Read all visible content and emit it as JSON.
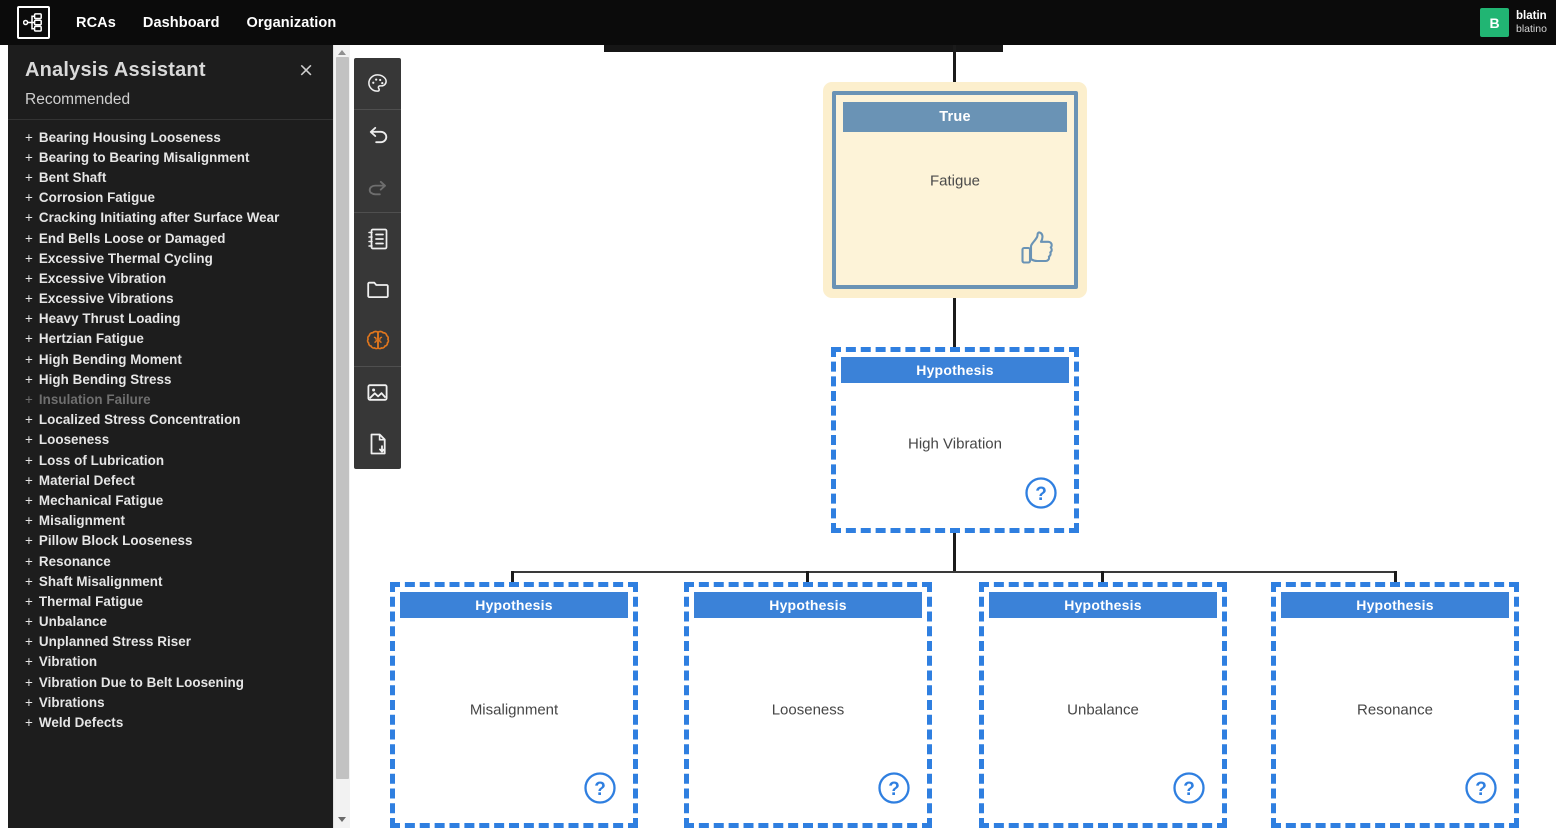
{
  "nav": {
    "logo_icon": "rca-tree-logo-icon",
    "links": [
      {
        "label": "RCAs"
      },
      {
        "label": "Dashboard"
      },
      {
        "label": "Organization"
      }
    ],
    "user": {
      "avatar_initial": "B",
      "name": "blatin",
      "sub": "blatino"
    }
  },
  "panel": {
    "title": "Analysis Assistant",
    "close_label": "×",
    "section_label": "Recommended",
    "items": [
      {
        "label": "Bearing Housing Looseness",
        "disabled": false
      },
      {
        "label": "Bearing to Bearing Misalignment",
        "disabled": false
      },
      {
        "label": "Bent Shaft",
        "disabled": false
      },
      {
        "label": "Corrosion Fatigue",
        "disabled": false
      },
      {
        "label": "Cracking Initiating after Surface Wear",
        "disabled": false
      },
      {
        "label": "End Bells Loose or Damaged",
        "disabled": false
      },
      {
        "label": "Excessive Thermal Cycling",
        "disabled": false
      },
      {
        "label": "Excessive Vibration",
        "disabled": false
      },
      {
        "label": "Excessive Vibrations",
        "disabled": false
      },
      {
        "label": "Heavy Thrust Loading",
        "disabled": false
      },
      {
        "label": "Hertzian Fatigue",
        "disabled": false
      },
      {
        "label": "High Bending Moment",
        "disabled": false
      },
      {
        "label": "High Bending Stress",
        "disabled": false
      },
      {
        "label": "Insulation Failure",
        "disabled": true
      },
      {
        "label": "Localized Stress Concentration",
        "disabled": false
      },
      {
        "label": "Looseness",
        "disabled": false
      },
      {
        "label": "Loss of Lubrication",
        "disabled": false
      },
      {
        "label": "Material Defect",
        "disabled": false
      },
      {
        "label": "Mechanical Fatigue",
        "disabled": false
      },
      {
        "label": "Misalignment",
        "disabled": false
      },
      {
        "label": "Pillow Block Looseness",
        "disabled": false
      },
      {
        "label": "Resonance",
        "disabled": false
      },
      {
        "label": "Shaft Misalignment",
        "disabled": false
      },
      {
        "label": "Thermal Fatigue",
        "disabled": false
      },
      {
        "label": "Unbalance",
        "disabled": false
      },
      {
        "label": "Unplanned Stress Riser",
        "disabled": false
      },
      {
        "label": "Vibration",
        "disabled": false
      },
      {
        "label": "Vibration Due to Belt Loosening",
        "disabled": false
      },
      {
        "label": "Vibrations",
        "disabled": false
      },
      {
        "label": "Weld Defects",
        "disabled": false
      }
    ],
    "plus_glyph": "+"
  },
  "toolbar": {
    "groups": [
      [
        {
          "icon": "palette-icon",
          "active": false,
          "disabled": false
        }
      ],
      [
        {
          "icon": "undo-icon",
          "active": false,
          "disabled": false
        },
        {
          "icon": "redo-icon",
          "active": false,
          "disabled": true
        }
      ],
      [
        {
          "icon": "notebook-icon",
          "active": false,
          "disabled": false
        },
        {
          "icon": "folder-icon",
          "active": false,
          "disabled": false
        },
        {
          "icon": "brain-icon",
          "active": true,
          "disabled": false
        }
      ],
      [
        {
          "icon": "image-icon",
          "active": false,
          "disabled": false
        },
        {
          "icon": "file-download-icon",
          "active": false,
          "disabled": false
        }
      ]
    ]
  },
  "tree": {
    "root": {
      "type": "True",
      "header": "True",
      "body": "Fatigue",
      "badge_icon": "thumbs-up-icon"
    },
    "child": {
      "type": "Hypothesis",
      "header": "Hypothesis",
      "body": "High Vibration",
      "badge_icon": "question-circle-icon"
    },
    "leaves": [
      {
        "type": "Hypothesis",
        "header": "Hypothesis",
        "body": "Misalignment",
        "badge_icon": "question-circle-icon"
      },
      {
        "type": "Hypothesis",
        "header": "Hypothesis",
        "body": "Looseness",
        "badge_icon": "question-circle-icon"
      },
      {
        "type": "Hypothesis",
        "header": "Hypothesis",
        "body": "Unbalance",
        "badge_icon": "question-circle-icon"
      },
      {
        "type": "Hypothesis",
        "header": "Hypothesis",
        "body": "Resonance",
        "badge_icon": "question-circle-icon"
      }
    ]
  },
  "colors": {
    "nav_bg": "#0b0b0b",
    "panel_bg": "#1d1d1d",
    "avatar_green": "#21b573",
    "hypothesis_blue": "#3b82d8",
    "hypothesis_dash": "#2f7fe0",
    "true_border": "#6a93b5",
    "true_fill": "#fdf3d8",
    "true_glow": "#fcefcd",
    "toolbar_bg": "#373737",
    "brain_orange": "#e0761d"
  }
}
